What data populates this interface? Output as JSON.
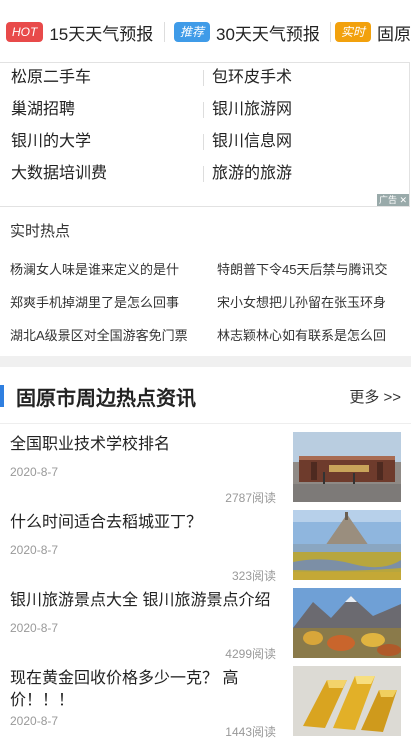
{
  "top_bar": {
    "items": [
      {
        "badge": "HOT",
        "badge_color": "#e84a4a",
        "text": "15天天气预报"
      },
      {
        "badge": "推荐",
        "badge_color": "#3f9be8",
        "text": "30天天气预报"
      },
      {
        "badge": "实时",
        "badge_color": "#f2a10d",
        "text": "固原"
      }
    ]
  },
  "ad_links": {
    "left": [
      "松原二手车",
      "巢湖招聘",
      "银川的大学",
      "大数据培训费"
    ],
    "right": [
      "包环皮手术",
      "银川旅游网",
      "银川信息网",
      "旅游的旅游"
    ],
    "ad_label": "广告"
  },
  "realtime": {
    "title": "实时热点",
    "items": [
      "杨澜女人味是谁来定义的是什",
      "特朗普下令45天后禁与腾讯交",
      "郑爽手机掉湖里了是怎么回事",
      "宋小女想把儿孙留在张玉环身",
      "湖北A级景区对全国游客免门票",
      "林志颖林心如有联系是怎么回"
    ]
  },
  "section": {
    "title": "固原市周边热点资讯",
    "more": "更多 >>",
    "accent": "#2f7fe0"
  },
  "news": [
    {
      "title": "全国职业技术学校排名",
      "date": "2020-8-7",
      "reads": "2787阅读",
      "image": "school-gate-photo"
    },
    {
      "title": "什么时间适合去稻城亚丁？",
      "date": "2020-8-7",
      "reads": "323阅读",
      "image": "island-castle-photo"
    },
    {
      "title": "银川旅游景点大全 银川旅游景点介绍",
      "date": "2020-8-7",
      "reads": "4299阅读",
      "image": "mountain-landscape-photo"
    },
    {
      "title": "现在黄金回收价格多少一克？ 高价！！！",
      "date": "2020-8-7",
      "reads": "1443阅读",
      "image": "gold-bars-photo"
    }
  ]
}
